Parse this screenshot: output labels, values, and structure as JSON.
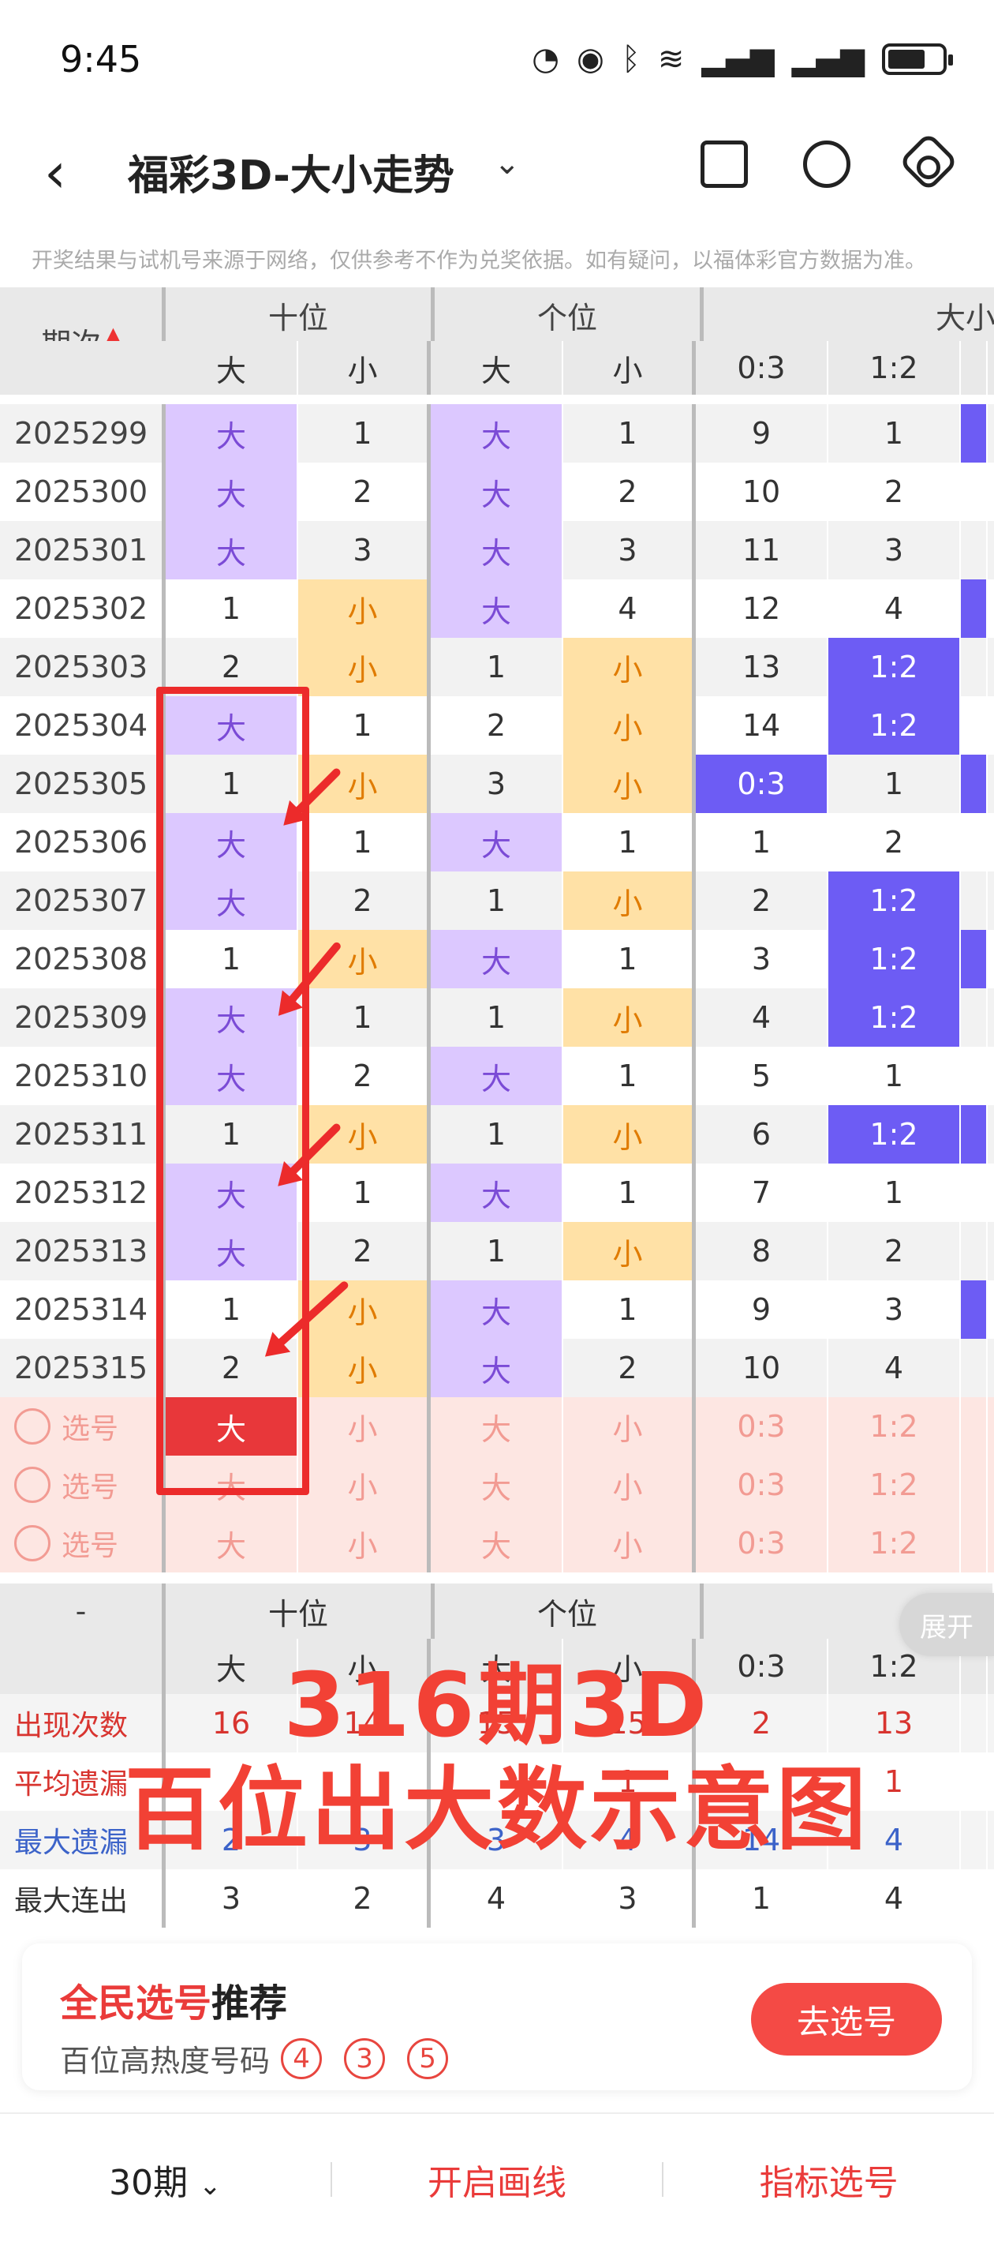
{
  "status": {
    "time": "9:45"
  },
  "header": {
    "title": "福彩3D-大小走势"
  },
  "disclaimer": "开奖结果与试机号来源于网络，仅供参考不作为兑奖依据。如有疑问，以福体彩官方数据为准。",
  "table": {
    "issue_header": "期次",
    "groups": [
      "十位",
      "个位",
      "大小比"
    ],
    "subheaders": [
      "大",
      "小",
      "大",
      "小",
      "0:3",
      "1:2"
    ],
    "rows": [
      {
        "issue": "2025299",
        "c": [
          "大",
          "1",
          "大",
          "1",
          "9",
          "1"
        ],
        "t": [
          "b",
          "n",
          "b",
          "n",
          "n",
          "n"
        ]
      },
      {
        "issue": "2025300",
        "c": [
          "大",
          "2",
          "大",
          "2",
          "10",
          "2"
        ],
        "t": [
          "b",
          "n",
          "b",
          "n",
          "n",
          "n"
        ]
      },
      {
        "issue": "2025301",
        "c": [
          "大",
          "3",
          "大",
          "3",
          "11",
          "3"
        ],
        "t": [
          "b",
          "n",
          "b",
          "n",
          "n",
          "n"
        ]
      },
      {
        "issue": "2025302",
        "c": [
          "1",
          "小",
          "大",
          "4",
          "12",
          "4"
        ],
        "t": [
          "n",
          "s",
          "b",
          "n",
          "n",
          "n"
        ]
      },
      {
        "issue": "2025303",
        "c": [
          "2",
          "小",
          "1",
          "小",
          "13",
          "1:2"
        ],
        "t": [
          "n",
          "s",
          "n",
          "s",
          "n",
          "r"
        ]
      },
      {
        "issue": "2025304",
        "c": [
          "大",
          "1",
          "2",
          "小",
          "14",
          "1:2"
        ],
        "t": [
          "b",
          "n",
          "n",
          "s",
          "n",
          "r"
        ]
      },
      {
        "issue": "2025305",
        "c": [
          "1",
          "小",
          "3",
          "小",
          "0:3",
          "1"
        ],
        "t": [
          "n",
          "s",
          "n",
          "s",
          "r",
          "n"
        ]
      },
      {
        "issue": "2025306",
        "c": [
          "大",
          "1",
          "大",
          "1",
          "1",
          "2"
        ],
        "t": [
          "b",
          "n",
          "b",
          "n",
          "n",
          "n"
        ]
      },
      {
        "issue": "2025307",
        "c": [
          "大",
          "2",
          "1",
          "小",
          "2",
          "1:2"
        ],
        "t": [
          "b",
          "n",
          "n",
          "s",
          "n",
          "r"
        ]
      },
      {
        "issue": "2025308",
        "c": [
          "1",
          "小",
          "大",
          "1",
          "3",
          "1:2"
        ],
        "t": [
          "n",
          "s",
          "b",
          "n",
          "n",
          "r"
        ]
      },
      {
        "issue": "2025309",
        "c": [
          "大",
          "1",
          "1",
          "小",
          "4",
          "1:2"
        ],
        "t": [
          "b",
          "n",
          "n",
          "s",
          "n",
          "r"
        ]
      },
      {
        "issue": "2025310",
        "c": [
          "大",
          "2",
          "大",
          "1",
          "5",
          "1"
        ],
        "t": [
          "b",
          "n",
          "b",
          "n",
          "n",
          "n"
        ]
      },
      {
        "issue": "2025311",
        "c": [
          "1",
          "小",
          "1",
          "小",
          "6",
          "1:2"
        ],
        "t": [
          "n",
          "s",
          "n",
          "s",
          "n",
          "r"
        ]
      },
      {
        "issue": "2025312",
        "c": [
          "大",
          "1",
          "大",
          "1",
          "7",
          "1"
        ],
        "t": [
          "b",
          "n",
          "b",
          "n",
          "n",
          "n"
        ]
      },
      {
        "issue": "2025313",
        "c": [
          "大",
          "2",
          "1",
          "小",
          "8",
          "2"
        ],
        "t": [
          "b",
          "n",
          "n",
          "s",
          "n",
          "n"
        ]
      },
      {
        "issue": "2025314",
        "c": [
          "1",
          "小",
          "大",
          "1",
          "9",
          "3"
        ],
        "t": [
          "n",
          "s",
          "b",
          "n",
          "n",
          "n"
        ]
      },
      {
        "issue": "2025315",
        "c": [
          "2",
          "小",
          "大",
          "2",
          "10",
          "4"
        ],
        "t": [
          "n",
          "s",
          "b",
          "n",
          "n",
          "n"
        ]
      }
    ],
    "pick_label": "选号",
    "pick_cells": [
      "大",
      "小",
      "大",
      "小",
      "0:3",
      "1:2"
    ]
  },
  "stats": {
    "dash": "-",
    "groups": [
      "十位",
      "个位"
    ],
    "subheaders": [
      "大",
      "小",
      "大",
      "小",
      "0:3",
      "1:2"
    ],
    "expand_label": "展开",
    "rows": [
      {
        "label": "出现次数",
        "vals": [
          "16",
          "14",
          "15",
          "15",
          "2",
          "13"
        ],
        "color": "red"
      },
      {
        "label": "平均遗漏",
        "vals": [
          "",
          "",
          "",
          "1",
          "",
          "1"
        ],
        "color": "red"
      },
      {
        "label": "最大遗漏",
        "vals": [
          "2",
          "3",
          "3",
          "4",
          "14",
          "4"
        ],
        "color": "blue"
      },
      {
        "label": "最大连出",
        "vals": [
          "3",
          "2",
          "4",
          "3",
          "1",
          "4"
        ],
        "color": "dark"
      }
    ]
  },
  "overlay": {
    "line1": "316期3D",
    "line2": "百位出大数示意图"
  },
  "recommend": {
    "title_red": "全民选号",
    "title_dark": "推荐",
    "sub": "百位高热度号码",
    "balls": [
      "4",
      "3",
      "5"
    ],
    "button": "去选号"
  },
  "bottom": {
    "periods": "30期",
    "draw_line": "开启画线",
    "indicator": "指标选号"
  },
  "colors": {
    "big": "#dcc8ff",
    "small": "#ffe1a6",
    "ratio": "#6d5cf4",
    "accent": "#ea3b3a"
  }
}
